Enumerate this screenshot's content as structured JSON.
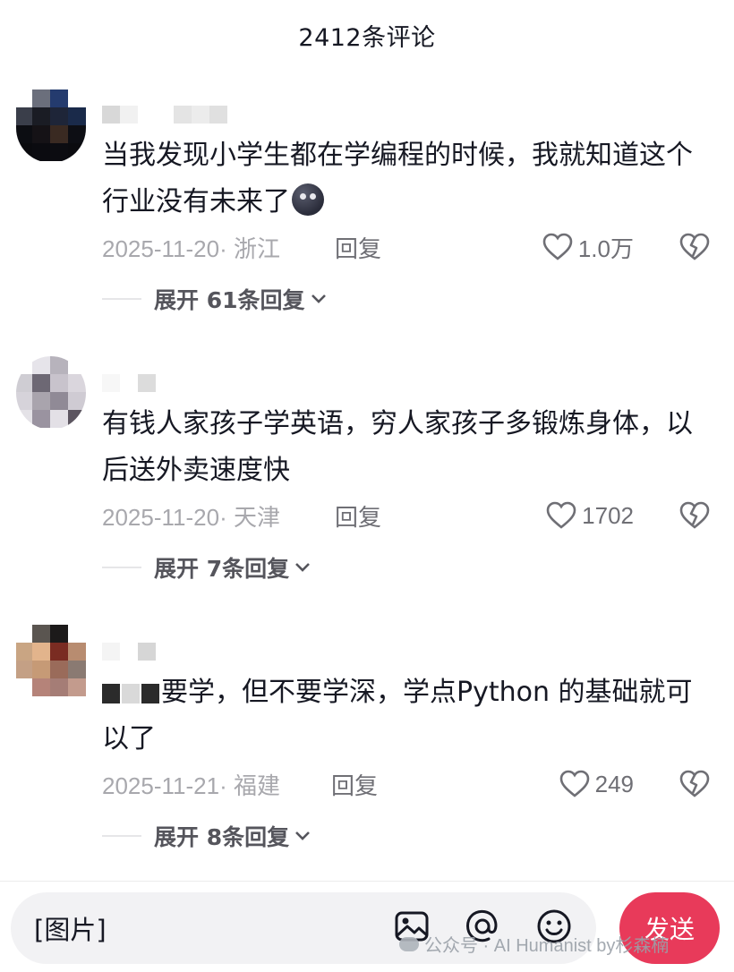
{
  "header": {
    "title": "2412条评论"
  },
  "colors": {
    "send_button": "#e83a5a",
    "input_bg": "#f2f2f4",
    "meta_gray": "#a8a8ad"
  },
  "comments": [
    {
      "text": "当我发现小学生都在学编程的时候，我就知道这个行业没有未来了",
      "emoji": "new-moon-face-emoji",
      "date": "2025-11-20· 浙江",
      "reply_label": "回复",
      "likes": "1.0万",
      "expand_label": "展开 61条回复"
    },
    {
      "text": "有钱人家孩子学英语，穷人家孩子多锻炼身体，以后送外卖速度快",
      "date": "2025-11-20· 天津",
      "reply_label": "回复",
      "likes": "1702",
      "expand_label": "展开 7条回复"
    },
    {
      "text_prefix_censored": true,
      "text": "要学，但不要学深，学点Python 的基础就可以了",
      "date": "2025-11-21· 福建",
      "reply_label": "回复",
      "likes": "249",
      "expand_label": "展开 8条回复"
    }
  ],
  "input": {
    "value": "[图片]",
    "icons": [
      "image-icon",
      "at-icon",
      "emoji-icon"
    ]
  },
  "send_label": "发送",
  "watermark": "公众号 · AI Humanist by杉森楠"
}
